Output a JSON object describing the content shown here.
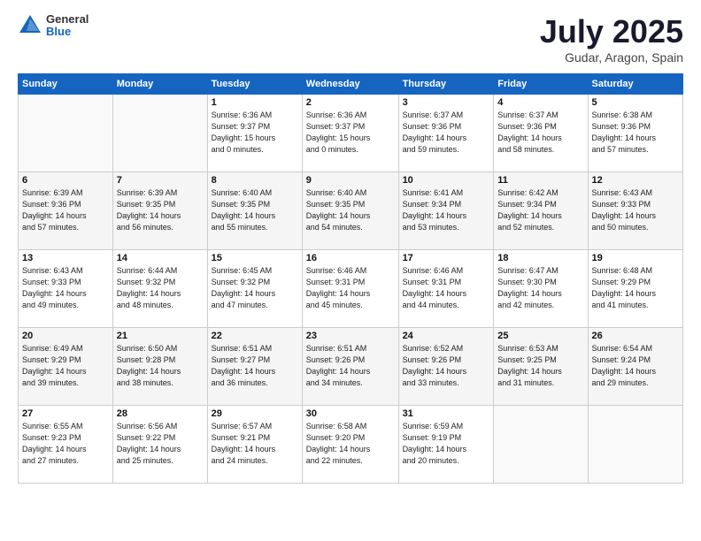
{
  "header": {
    "logo_general": "General",
    "logo_blue": "Blue",
    "month_title": "July 2025",
    "location": "Gudar, Aragon, Spain"
  },
  "weekdays": [
    "Sunday",
    "Monday",
    "Tuesday",
    "Wednesday",
    "Thursday",
    "Friday",
    "Saturday"
  ],
  "weeks": [
    [
      {
        "day": "",
        "info": ""
      },
      {
        "day": "",
        "info": ""
      },
      {
        "day": "1",
        "info": "Sunrise: 6:36 AM\nSunset: 9:37 PM\nDaylight: 15 hours\nand 0 minutes."
      },
      {
        "day": "2",
        "info": "Sunrise: 6:36 AM\nSunset: 9:37 PM\nDaylight: 15 hours\nand 0 minutes."
      },
      {
        "day": "3",
        "info": "Sunrise: 6:37 AM\nSunset: 9:36 PM\nDaylight: 14 hours\nand 59 minutes."
      },
      {
        "day": "4",
        "info": "Sunrise: 6:37 AM\nSunset: 9:36 PM\nDaylight: 14 hours\nand 58 minutes."
      },
      {
        "day": "5",
        "info": "Sunrise: 6:38 AM\nSunset: 9:36 PM\nDaylight: 14 hours\nand 57 minutes."
      }
    ],
    [
      {
        "day": "6",
        "info": "Sunrise: 6:39 AM\nSunset: 9:36 PM\nDaylight: 14 hours\nand 57 minutes."
      },
      {
        "day": "7",
        "info": "Sunrise: 6:39 AM\nSunset: 9:35 PM\nDaylight: 14 hours\nand 56 minutes."
      },
      {
        "day": "8",
        "info": "Sunrise: 6:40 AM\nSunset: 9:35 PM\nDaylight: 14 hours\nand 55 minutes."
      },
      {
        "day": "9",
        "info": "Sunrise: 6:40 AM\nSunset: 9:35 PM\nDaylight: 14 hours\nand 54 minutes."
      },
      {
        "day": "10",
        "info": "Sunrise: 6:41 AM\nSunset: 9:34 PM\nDaylight: 14 hours\nand 53 minutes."
      },
      {
        "day": "11",
        "info": "Sunrise: 6:42 AM\nSunset: 9:34 PM\nDaylight: 14 hours\nand 52 minutes."
      },
      {
        "day": "12",
        "info": "Sunrise: 6:43 AM\nSunset: 9:33 PM\nDaylight: 14 hours\nand 50 minutes."
      }
    ],
    [
      {
        "day": "13",
        "info": "Sunrise: 6:43 AM\nSunset: 9:33 PM\nDaylight: 14 hours\nand 49 minutes."
      },
      {
        "day": "14",
        "info": "Sunrise: 6:44 AM\nSunset: 9:32 PM\nDaylight: 14 hours\nand 48 minutes."
      },
      {
        "day": "15",
        "info": "Sunrise: 6:45 AM\nSunset: 9:32 PM\nDaylight: 14 hours\nand 47 minutes."
      },
      {
        "day": "16",
        "info": "Sunrise: 6:46 AM\nSunset: 9:31 PM\nDaylight: 14 hours\nand 45 minutes."
      },
      {
        "day": "17",
        "info": "Sunrise: 6:46 AM\nSunset: 9:31 PM\nDaylight: 14 hours\nand 44 minutes."
      },
      {
        "day": "18",
        "info": "Sunrise: 6:47 AM\nSunset: 9:30 PM\nDaylight: 14 hours\nand 42 minutes."
      },
      {
        "day": "19",
        "info": "Sunrise: 6:48 AM\nSunset: 9:29 PM\nDaylight: 14 hours\nand 41 minutes."
      }
    ],
    [
      {
        "day": "20",
        "info": "Sunrise: 6:49 AM\nSunset: 9:29 PM\nDaylight: 14 hours\nand 39 minutes."
      },
      {
        "day": "21",
        "info": "Sunrise: 6:50 AM\nSunset: 9:28 PM\nDaylight: 14 hours\nand 38 minutes."
      },
      {
        "day": "22",
        "info": "Sunrise: 6:51 AM\nSunset: 9:27 PM\nDaylight: 14 hours\nand 36 minutes."
      },
      {
        "day": "23",
        "info": "Sunrise: 6:51 AM\nSunset: 9:26 PM\nDaylight: 14 hours\nand 34 minutes."
      },
      {
        "day": "24",
        "info": "Sunrise: 6:52 AM\nSunset: 9:26 PM\nDaylight: 14 hours\nand 33 minutes."
      },
      {
        "day": "25",
        "info": "Sunrise: 6:53 AM\nSunset: 9:25 PM\nDaylight: 14 hours\nand 31 minutes."
      },
      {
        "day": "26",
        "info": "Sunrise: 6:54 AM\nSunset: 9:24 PM\nDaylight: 14 hours\nand 29 minutes."
      }
    ],
    [
      {
        "day": "27",
        "info": "Sunrise: 6:55 AM\nSunset: 9:23 PM\nDaylight: 14 hours\nand 27 minutes."
      },
      {
        "day": "28",
        "info": "Sunrise: 6:56 AM\nSunset: 9:22 PM\nDaylight: 14 hours\nand 25 minutes."
      },
      {
        "day": "29",
        "info": "Sunrise: 6:57 AM\nSunset: 9:21 PM\nDaylight: 14 hours\nand 24 minutes."
      },
      {
        "day": "30",
        "info": "Sunrise: 6:58 AM\nSunset: 9:20 PM\nDaylight: 14 hours\nand 22 minutes."
      },
      {
        "day": "31",
        "info": "Sunrise: 6:59 AM\nSunset: 9:19 PM\nDaylight: 14 hours\nand 20 minutes."
      },
      {
        "day": "",
        "info": ""
      },
      {
        "day": "",
        "info": ""
      }
    ]
  ]
}
